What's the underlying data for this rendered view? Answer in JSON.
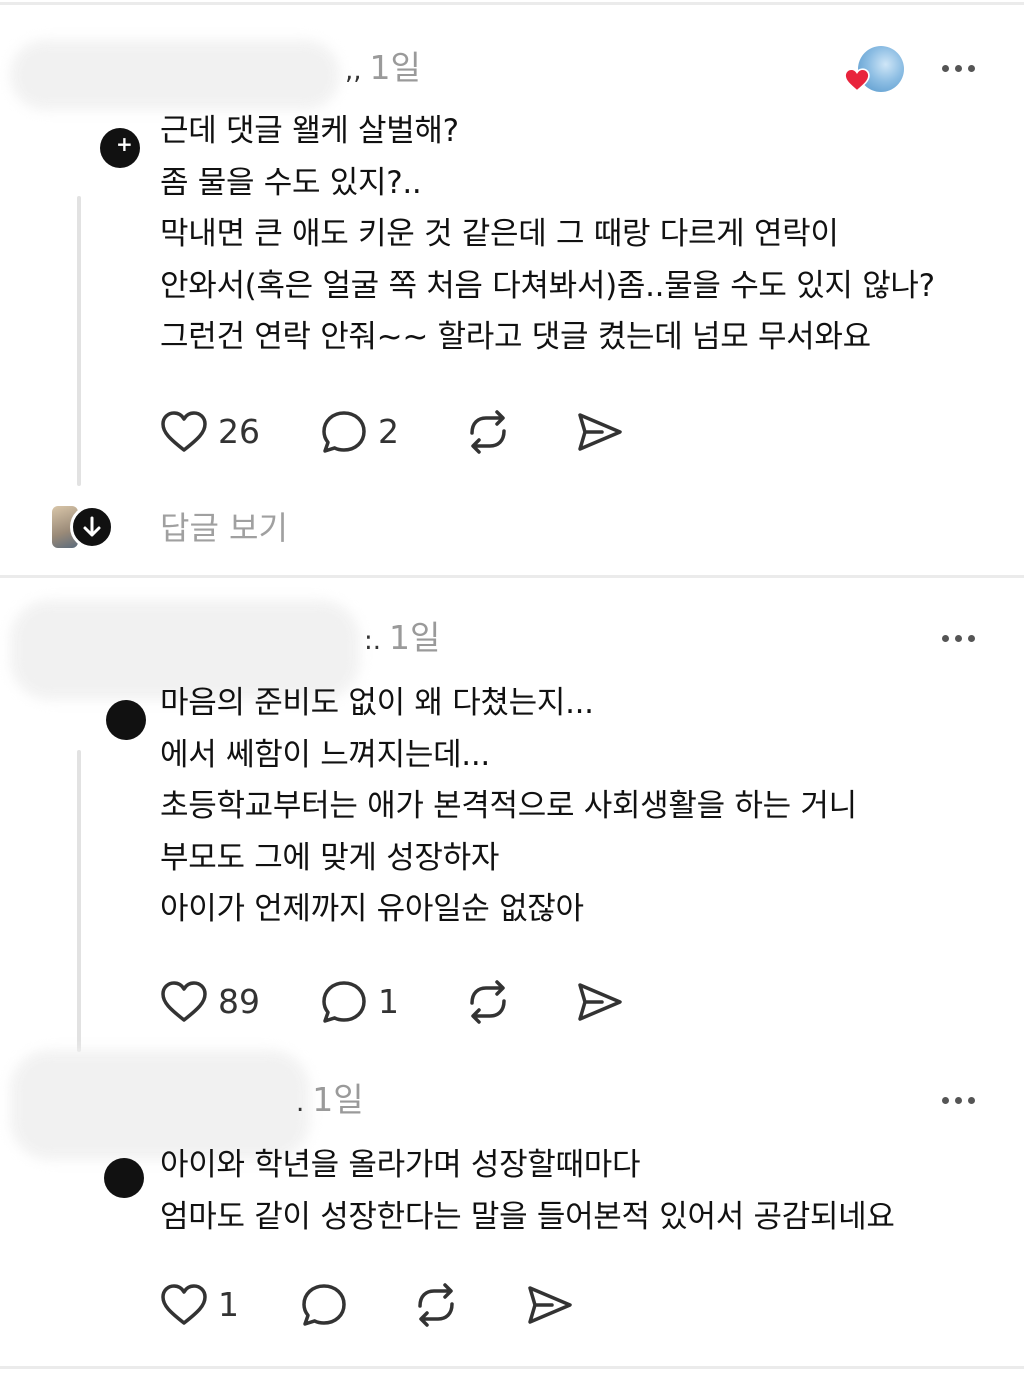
{
  "posts": [
    {
      "time": "1일",
      "lines": [
        "근데 댓글 왤케 살벌해?",
        "좀 물을 수도 있지?..",
        "막내면 큰 애도 키운 것 같은데 그 때랑 다르게 연락이",
        "안와서(혹은 얼굴 쪽 처음 다쳐봐서)좀..물을 수도 있지 않나?",
        "그런건 연락 안줘~~ 할라고 댓글 켰는데 넘모 무서와요"
      ],
      "likes": "26",
      "comments": "2"
    },
    {
      "time": "1일",
      "lines": [
        "마음의 준비도 없이 왜 다쳤는지...",
        "에서 쎄함이 느껴지는데...",
        "초등학교부터는 애가 본격적으로 사회생활을 하는 거니",
        "부모도 그에 맞게 성장하자",
        "아이가 언제까지 유아일순 없잖아"
      ],
      "likes": "89",
      "comments": "1"
    },
    {
      "time": "1일",
      "lines": [
        "아이와 학년을 올라가며 성장할때마다",
        "엄마도 같이 성장한다는 말을 들어본적 있어서 공감되네요"
      ],
      "likes": "1",
      "comments": ""
    }
  ],
  "view_replies": "답글 보기",
  "icons": {
    "like": "heart-icon",
    "comment": "comment-bubble-icon",
    "repost": "repost-icon",
    "share": "send-icon",
    "more": "more-dots-icon"
  },
  "colors": {
    "liked_heart": "#e8243c",
    "muted_text": "#9a9a9a"
  }
}
